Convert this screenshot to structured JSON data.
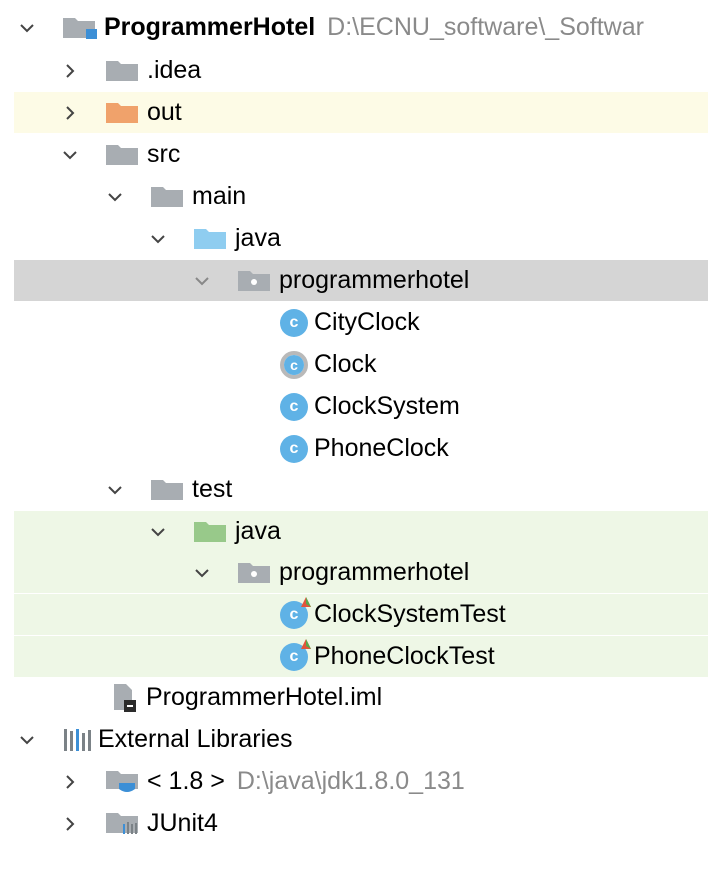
{
  "tree": {
    "project": {
      "name": "ProgrammerHotel",
      "path": "D:\\ECNU_software\\_Softwar"
    },
    "idea": ".idea",
    "out": "out",
    "src": "src",
    "main": "main",
    "main_java": "java",
    "main_package": "programmerhotel",
    "classes": [
      "CityClock",
      "Clock",
      "ClockSystem",
      "PhoneClock"
    ],
    "test": "test",
    "test_java": "java",
    "test_package": "programmerhotel",
    "test_classes": [
      "ClockSystemTest",
      "PhoneClockTest"
    ],
    "iml": "ProgrammerHotel.iml",
    "external_libraries": "External Libraries",
    "jdk": {
      "name": "< 1.8 >",
      "path": "D:\\java\\jdk1.8.0_131"
    },
    "junit": "JUnit4"
  },
  "colors": {
    "folder_gray": "#a8adb2",
    "folder_orange": "#f0a26b",
    "folder_blue": "#8fcdf0",
    "folder_green": "#98c98a",
    "class_blue": "#5fb2e6",
    "highlight_yellow": "#fdfbe6",
    "highlight_gray": "#d5d5d5",
    "highlight_green": "#eef7e6"
  }
}
